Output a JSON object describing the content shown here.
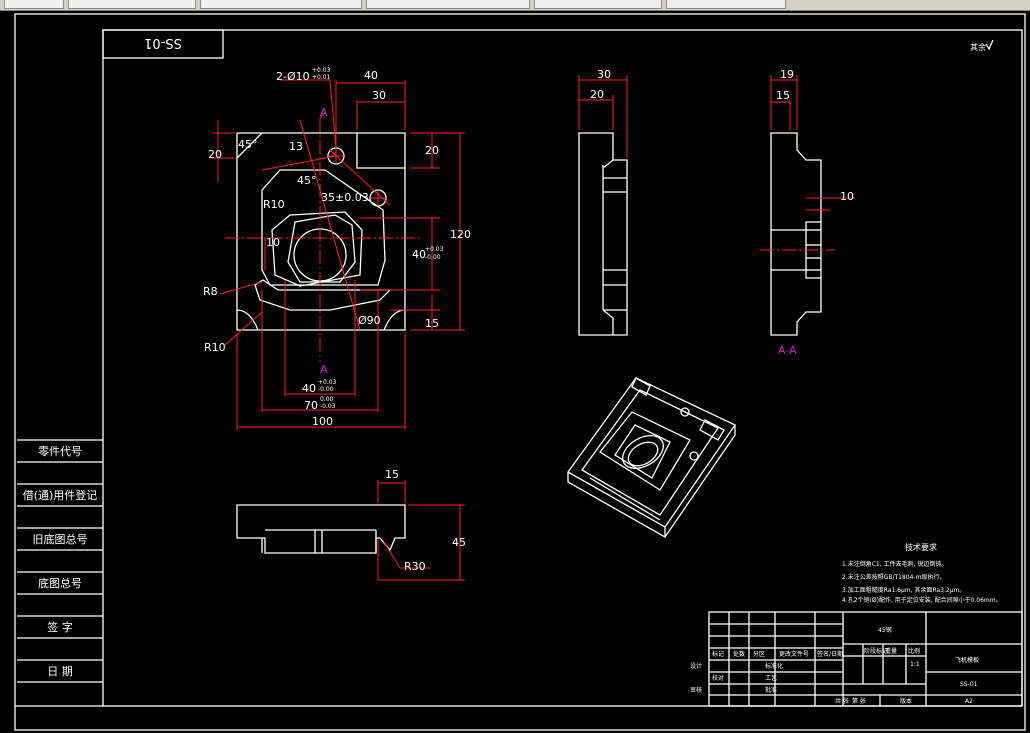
{
  "drawing_number": "SS-01",
  "roughness_note": "其余",
  "left_column": [
    "零件代号",
    "借(通)用件登记",
    "旧底图总号",
    "底图总号",
    "签  字",
    "日  期"
  ],
  "views": {
    "front": {
      "dims": {
        "holes": "2-Ø10",
        "holes_tol_upper": "+0.03",
        "holes_tol_lower": "+0.01",
        "top_40": "40",
        "top_30": "30",
        "left_20": "20",
        "right_20": "20",
        "angle_a": "45°",
        "angle_b": "45°",
        "d13": "13",
        "d35": "35±0.03",
        "r10_top": "R10",
        "d10": "10",
        "d120": "120",
        "d40v": "40",
        "d40v_upper": "+0.03",
        "d40v_lower": "-0.00",
        "r8": "R8",
        "d90": "Ø90",
        "d15": "15",
        "r10_bottom": "R10",
        "d40h": "40",
        "d40h_upper": "+0.03",
        "d40h_lower": "-0.00",
        "d70h": "70",
        "d70h_upper": "0.00",
        "d70h_lower": "-0.03",
        "d100": "100"
      },
      "section_a_top": "A",
      "section_a_bottom": "A"
    },
    "side": {
      "d30": "30",
      "d20": "20"
    },
    "section": {
      "d19": "19",
      "d15": "15",
      "d10": "10",
      "label": "A-A"
    },
    "bottom": {
      "d15": "15",
      "d45": "45",
      "r30": "R30"
    }
  },
  "tech_req": {
    "title": "技术要求",
    "lines": [
      "1.未注倒角C1, 工件去毛刺, 锐边倒钝。",
      "2.未注公差按照GB/T1804-m级执行。",
      "3.加工面粗糙度Ra1.6μm, 其余面Ra3.2μm。",
      "4.孔2个销(Ø)配作, 用于定位安装, 配合间隙小于0.06mm。"
    ]
  },
  "title_block": {
    "material": "45钢",
    "part_name": "飞机模板",
    "code": "SS-01",
    "size": "A2",
    "labels": {
      "mark": "标记",
      "count": "处数",
      "zone": "分区",
      "change_no": "更改文件号",
      "sign_date": "签名/日期",
      "design": "设计",
      "standardize": "标准化",
      "proofread": "校对",
      "process": "工艺",
      "audit": "审核",
      "approve": "批准",
      "stage": "阶段标记",
      "weight": "重量",
      "scale": "比例",
      "ratio": "1:1",
      "sheet_total": "共  张",
      "sheet_no": "第  张",
      "version": "版本"
    }
  }
}
